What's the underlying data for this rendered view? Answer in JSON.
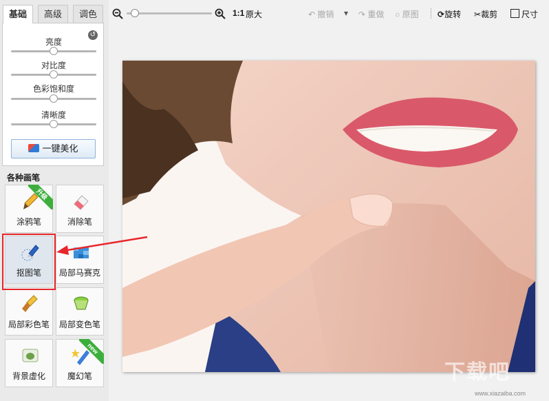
{
  "tabs": [
    "基础",
    "高级",
    "调色"
  ],
  "adjustments": [
    {
      "label": "亮度",
      "level": 0.5
    },
    {
      "label": "对比度",
      "level": 0.5
    },
    {
      "label": "色彩饱和度",
      "level": 0.5
    },
    {
      "label": "清晰度",
      "level": 0.5
    }
  ],
  "beautify_label": "一键美化",
  "brush_heading": "各种画笔",
  "tools": [
    {
      "label": "涂鸦笔",
      "badge": "升级"
    },
    {
      "label": "消除笔"
    },
    {
      "label": "抠图笔"
    },
    {
      "label": "局部马赛克"
    },
    {
      "label": "局部彩色笔"
    },
    {
      "label": "局部变色笔"
    },
    {
      "label": "背景虚化"
    },
    {
      "label": "魔幻笔",
      "badge": "new"
    }
  ],
  "toolbar": {
    "zoom_level": 0.05,
    "ratio": "1:1",
    "original_size": "原大",
    "undo": "撤销",
    "redo": "重做",
    "original": "原图",
    "rotate": "旋转",
    "crop": "裁剪",
    "resize": "尺寸"
  },
  "watermark": "下载吧",
  "watermark_url": "www.xiazaiba.com",
  "colors": {
    "highlight": "#e8252a",
    "arrow": "#e8252a",
    "badge_green": "#3cae3c"
  }
}
